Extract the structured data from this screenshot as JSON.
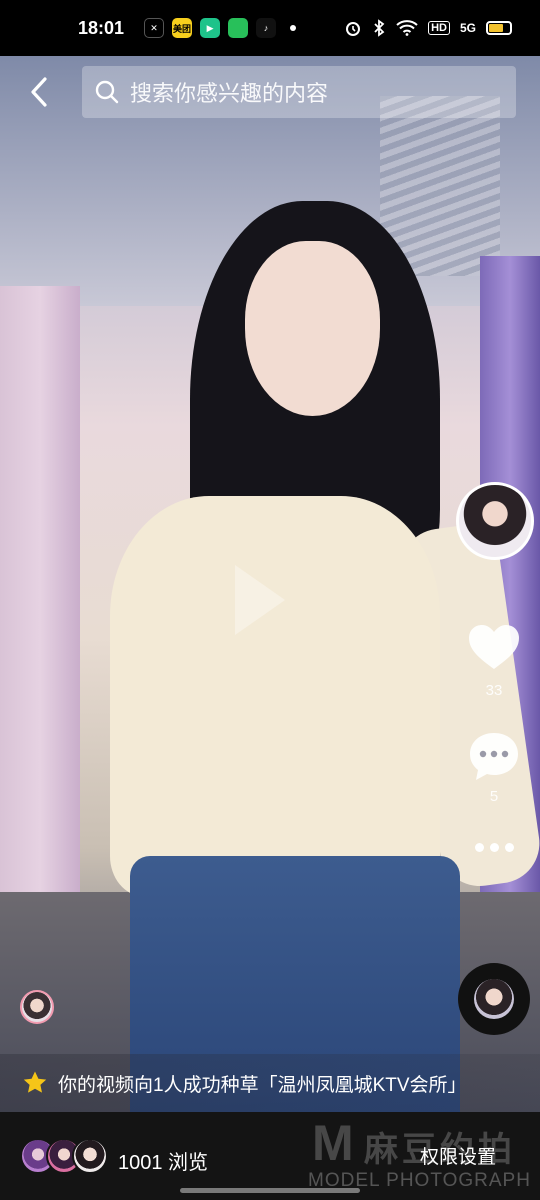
{
  "status_bar": {
    "time": "18:01",
    "apps": [
      {
        "icon": "capcut-icon",
        "label": "",
        "bg": "#000000"
      },
      {
        "icon": "meituan-icon",
        "label": "美团",
        "bg": "#f7cf1d"
      },
      {
        "icon": "video-app-icon",
        "label": "",
        "bg": "#1ec38a"
      },
      {
        "icon": "chat-app-icon",
        "label": "",
        "bg": "#28c05a"
      },
      {
        "icon": "tiktok-icon",
        "label": "♪",
        "bg": "#111111"
      }
    ],
    "network": "5G",
    "hd_label": "HD"
  },
  "search": {
    "placeholder": "搜索你感兴趣的内容"
  },
  "side": {
    "like_count": "33",
    "comment_count": "5"
  },
  "notice": {
    "text": "你的视频向1人成功种草「温州凤凰城KTV会所」"
  },
  "bottom": {
    "views": "1001 浏览",
    "permission_label": "权限设置",
    "watermark_letter": "M",
    "watermark_cn": "麻豆约拍",
    "watermark_en": "MODEL PHOTOGRAPH"
  },
  "colors": {
    "accent_star": "#f5c518",
    "battery": "#f3c22e"
  }
}
